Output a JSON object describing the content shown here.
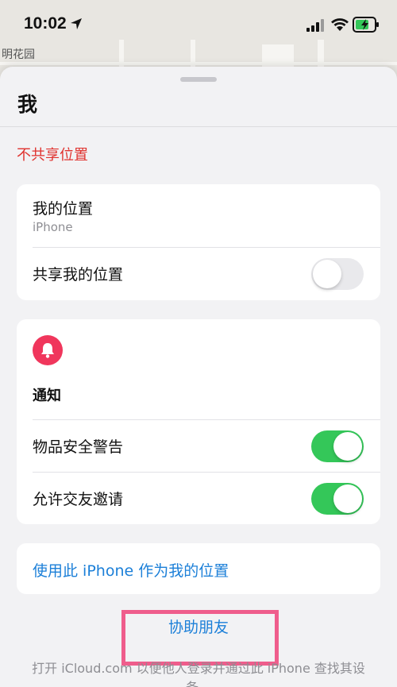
{
  "status_bar": {
    "time": "10:02"
  },
  "map": {
    "place_label": "明花园"
  },
  "sheet": {
    "title": "我",
    "stop_sharing": "不共享位置",
    "my_location": {
      "label": "我的位置",
      "device": "iPhone",
      "share_label": "共享我的位置",
      "share_enabled": false
    },
    "notifications": {
      "icon": "bell-icon",
      "title": "通知",
      "item_safety_label": "物品安全警告",
      "item_safety_enabled": true,
      "friend_requests_label": "允许交友邀请",
      "friend_requests_enabled": true
    },
    "use_this_iphone": "使用此 iPhone 作为我的位置",
    "help_friend": "协助朋友",
    "footnote": "打开 iCloud.com 以便他人登录并通过此 iPhone 查找其设备。"
  },
  "colors": {
    "destructive": "#e0322e",
    "link": "#1b7fd8",
    "toggle_on": "#34c759",
    "bell_badge": "#f0365c",
    "highlight_box": "#ef5d8c"
  }
}
